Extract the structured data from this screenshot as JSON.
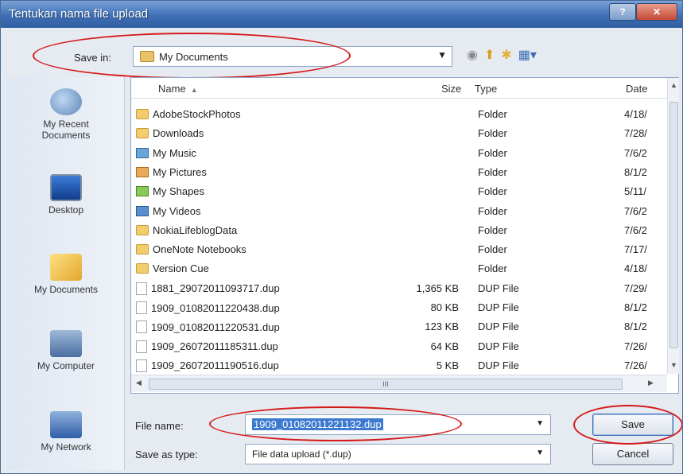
{
  "window": {
    "title": "Tentukan nama file upload",
    "help_label": "?",
    "close_label": "✕"
  },
  "save_in": {
    "label": "Save in:",
    "value": "My Documents"
  },
  "toolbar": {
    "back_icon": "back-icon",
    "up_icon": "up-folder-icon",
    "new_folder_icon": "new-folder-icon",
    "views_icon": "views-menu-icon"
  },
  "places": [
    {
      "label_1": "My Recent",
      "label_2": "Documents",
      "icon": "recent-documents-icon"
    },
    {
      "label_1": "Desktop",
      "label_2": "",
      "icon": "desktop-icon"
    },
    {
      "label_1": "My Documents",
      "label_2": "",
      "icon": "my-documents-icon"
    },
    {
      "label_1": "My Computer",
      "label_2": "",
      "icon": "my-computer-icon"
    },
    {
      "label_1": "My Network",
      "label_2": "",
      "icon": "my-network-icon"
    }
  ],
  "columns": {
    "name": "Name",
    "size": "Size",
    "type": "Type",
    "date": "Date"
  },
  "files": [
    {
      "name": "AdobeStockPhotos",
      "size": "",
      "type": "Folder",
      "date": "4/18/",
      "icon": "folder"
    },
    {
      "name": "Downloads",
      "size": "",
      "type": "Folder",
      "date": "7/28/",
      "icon": "folder"
    },
    {
      "name": "My Music",
      "size": "",
      "type": "Folder",
      "date": "7/6/2",
      "icon": "music"
    },
    {
      "name": "My Pictures",
      "size": "",
      "type": "Folder",
      "date": "8/1/2",
      "icon": "pictures"
    },
    {
      "name": "My Shapes",
      "size": "",
      "type": "Folder",
      "date": "5/11/",
      "icon": "shapes"
    },
    {
      "name": "My Videos",
      "size": "",
      "type": "Folder",
      "date": "7/6/2",
      "icon": "videos"
    },
    {
      "name": "NokiaLifeblogData",
      "size": "",
      "type": "Folder",
      "date": "7/6/2",
      "icon": "folder"
    },
    {
      "name": "OneNote Notebooks",
      "size": "",
      "type": "Folder",
      "date": "7/17/",
      "icon": "folder"
    },
    {
      "name": "Version Cue",
      "size": "",
      "type": "Folder",
      "date": "4/18/",
      "icon": "folder"
    },
    {
      "name": "1881_29072011093717.dup",
      "size": "1,365 KB",
      "type": "DUP File",
      "date": "7/29/",
      "icon": "file"
    },
    {
      "name": "1909_01082011220438.dup",
      "size": "80 KB",
      "type": "DUP File",
      "date": "8/1/2",
      "icon": "file"
    },
    {
      "name": "1909_01082011220531.dup",
      "size": "123 KB",
      "type": "DUP File",
      "date": "8/1/2",
      "icon": "file"
    },
    {
      "name": "1909_26072011185311.dup",
      "size": "64 KB",
      "type": "DUP File",
      "date": "7/26/",
      "icon": "file"
    },
    {
      "name": "1909_26072011190516.dup",
      "size": "5 KB",
      "type": "DUP File",
      "date": "7/26/",
      "icon": "file"
    }
  ],
  "scroll_text": "III",
  "file_name": {
    "label": "File name:",
    "value": "1909_01082011221132.dup"
  },
  "save_as_type": {
    "label": "Save as type:",
    "value": "File data upload (*.dup)"
  },
  "buttons": {
    "save": "Save",
    "cancel": "Cancel"
  },
  "colors": {
    "annotation_ring": "#d61818",
    "highlight": "#ffe600",
    "title_bar": "#3f6fb5"
  }
}
